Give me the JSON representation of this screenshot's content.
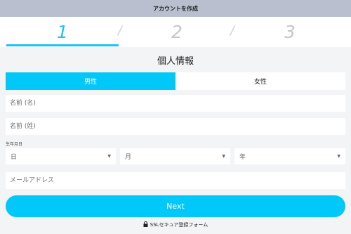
{
  "header": {
    "title": "アカウントを作成"
  },
  "steps": {
    "items": [
      "1",
      "2",
      "3"
    ],
    "active_index": 0,
    "separator": "/"
  },
  "section": {
    "title": "個人情報"
  },
  "gender": {
    "options": [
      "男性",
      "女性"
    ],
    "selected": "男性"
  },
  "form": {
    "first_name_placeholder": "名前 (名)",
    "last_name_placeholder": "名前 (姓)",
    "dob_label": "生年月日",
    "day_placeholder": "日",
    "month_placeholder": "月",
    "year_placeholder": "年",
    "email_placeholder": "メールアドレス"
  },
  "actions": {
    "next_label": "Next"
  },
  "footer": {
    "secure_text": "SSLセキュア登録フォーム",
    "secure_icon": "lock-icon"
  },
  "colors": {
    "accent": "#00c8f8",
    "topbar": "#b9bfcf",
    "background": "#f3f4f6"
  }
}
